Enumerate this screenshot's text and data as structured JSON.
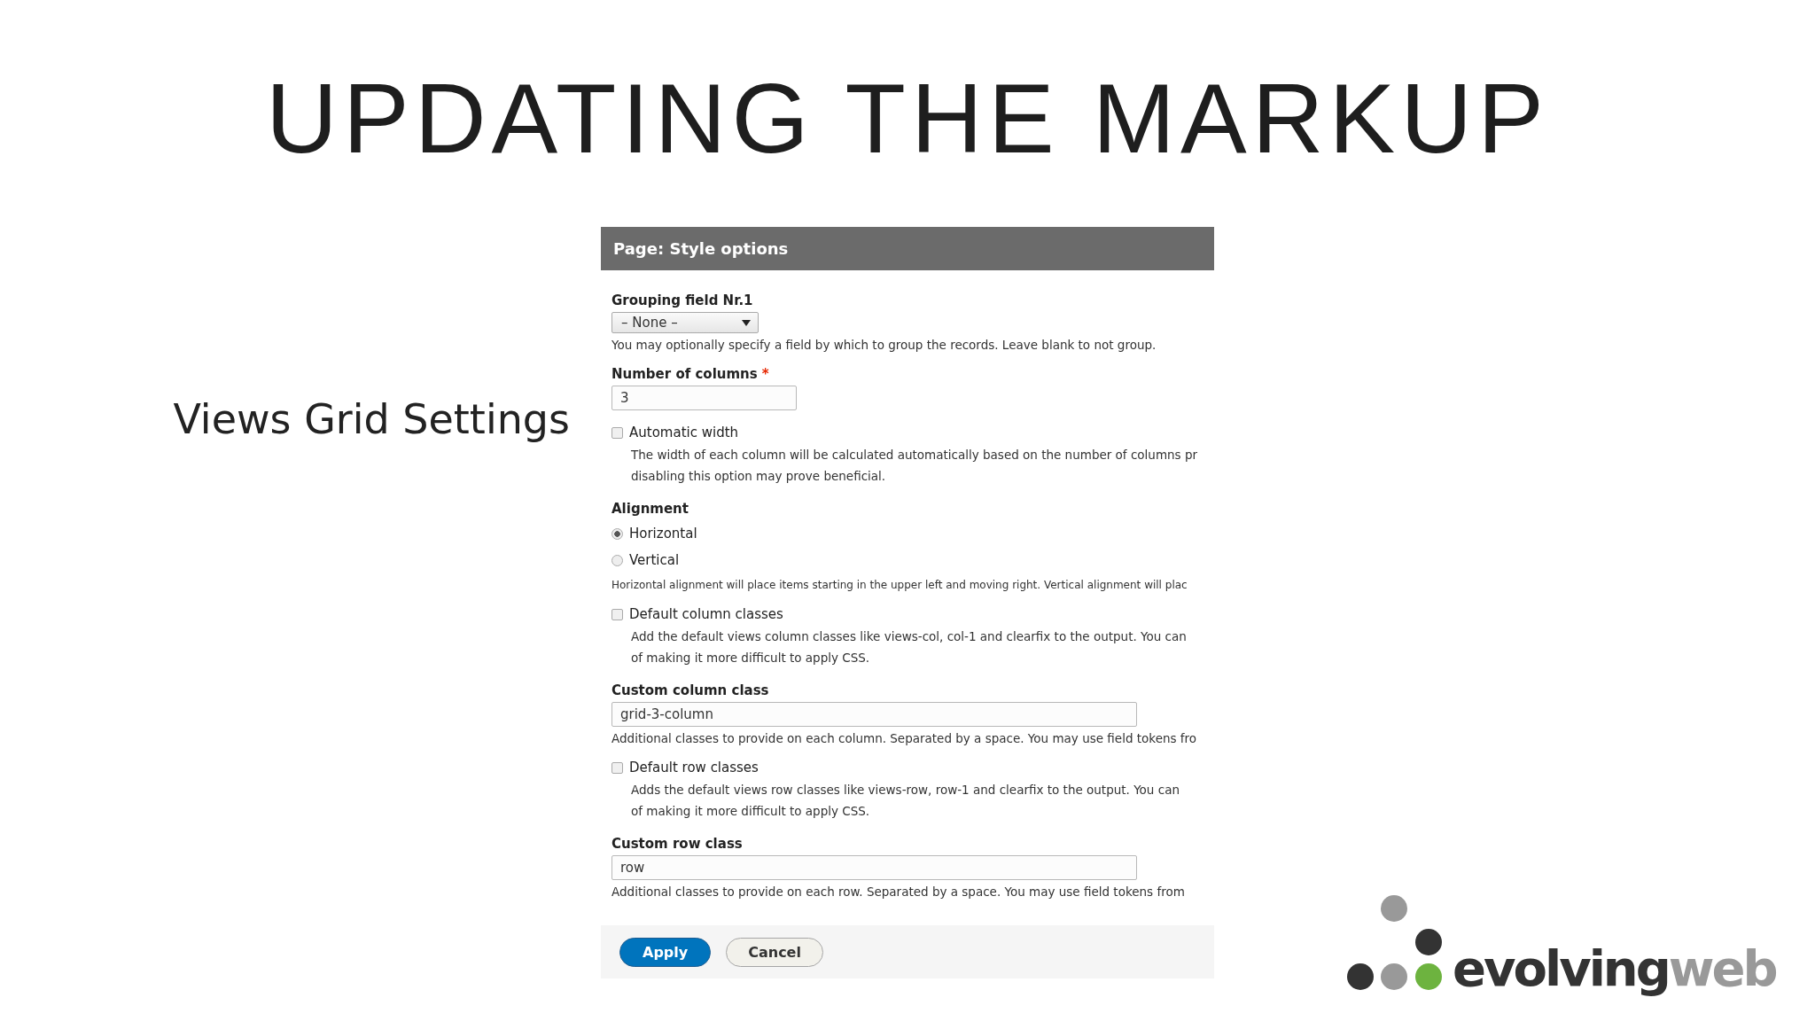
{
  "slide": {
    "title": "UPDATING THE MARKUP",
    "subtitle": "Views Grid Settings"
  },
  "dialog": {
    "title": "Page: Style options",
    "fields": [
      {
        "kind": "select",
        "label": "Grouping field Nr.1",
        "value": "– None –",
        "help": "You may optionally specify a field by which to group the records. Leave blank to not group."
      },
      {
        "kind": "short_text",
        "label": "Number of columns",
        "required_mark": "*",
        "value": "3"
      },
      {
        "kind": "checkbox",
        "label": "Automatic width",
        "checked": false,
        "description": [
          "The width of each column will be calculated automatically based on the number of columns pr",
          "disabling this option may prove beneficial."
        ]
      },
      {
        "kind": "radios",
        "label": "Alignment",
        "options": [
          {
            "label": "Horizontal",
            "selected": true
          },
          {
            "label": "Vertical",
            "selected": false
          }
        ],
        "help": "Horizontal alignment will place items starting in the upper left and moving right. Vertical alignment will plac"
      },
      {
        "kind": "checkbox",
        "label": "Default column classes",
        "checked": false,
        "description": [
          "Add the default views column classes like views-col, col-1 and clearfix to the output. You can",
          "of making it more difficult to apply CSS."
        ]
      },
      {
        "kind": "text",
        "label": "Custom column class",
        "value": "grid-3-column",
        "help": "Additional classes to provide on each column. Separated by a space. You may use field tokens fro"
      },
      {
        "kind": "checkbox",
        "label": "Default row classes",
        "checked": false,
        "description": [
          "Adds the default views row classes like views-row, row-1 and clearfix to the output. You can",
          "of making it more difficult to apply CSS."
        ]
      },
      {
        "kind": "text",
        "label": "Custom row class",
        "value": "row",
        "help": "Additional classes to provide on each row. Separated by a space. You may use field tokens from"
      }
    ],
    "buttons": [
      {
        "label": "Apply",
        "primary": true
      },
      {
        "label": "Cancel",
        "primary": false
      }
    ]
  },
  "logo": {
    "word_1": "evolving",
    "word_2": "web"
  }
}
